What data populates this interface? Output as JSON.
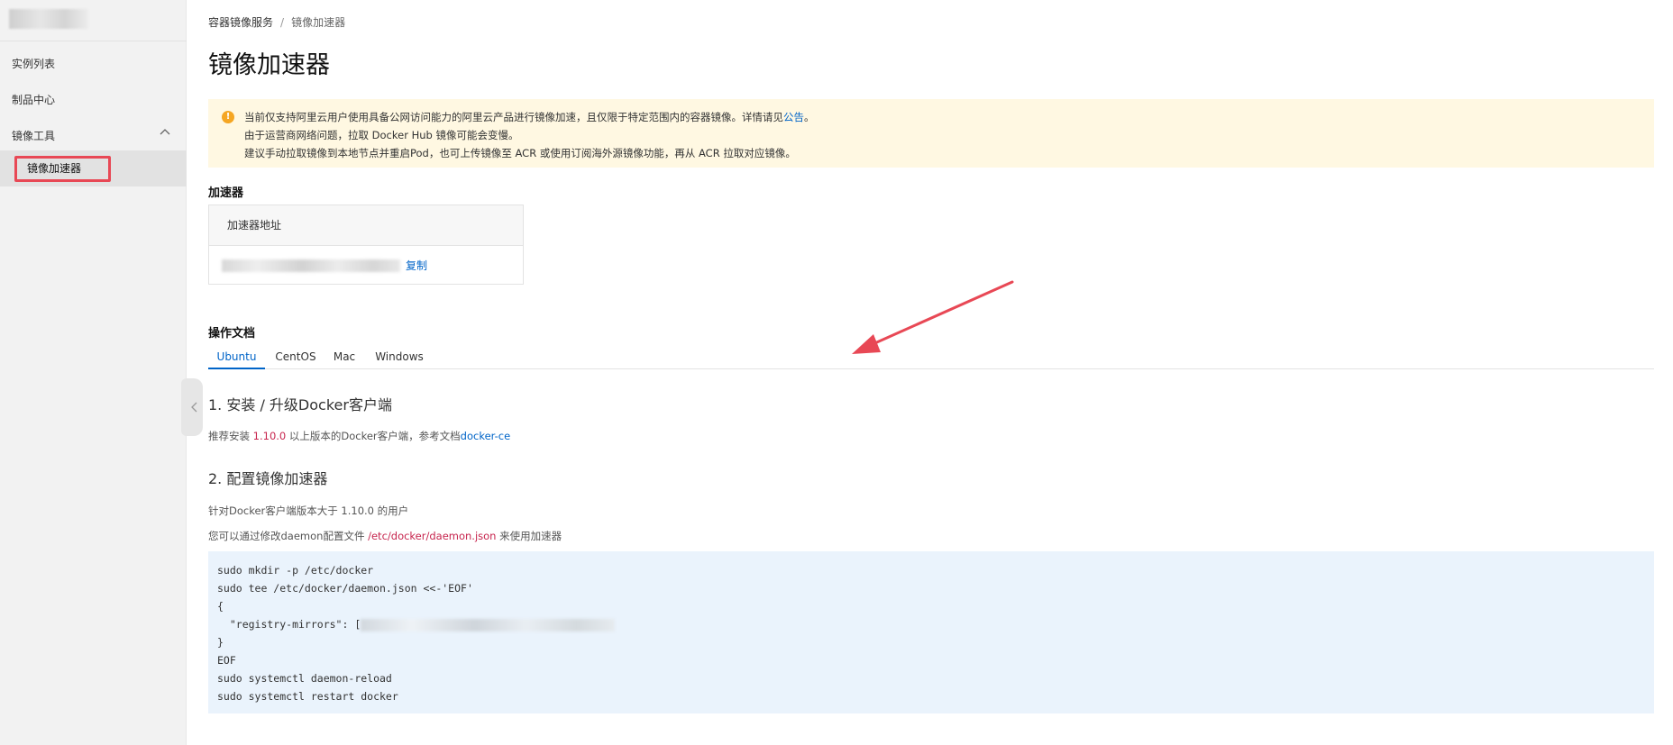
{
  "sidebar": {
    "items": [
      {
        "label": "实例列表"
      },
      {
        "label": "制品中心"
      },
      {
        "label": "镜像工具"
      }
    ],
    "active_item": "镜像加速器"
  },
  "breadcrumb": {
    "parent": "容器镜像服务",
    "separator": "/",
    "current": "镜像加速器"
  },
  "page_title": "镜像加速器",
  "notice": {
    "icon": "warning-icon",
    "line1_prefix": "当前仅支持阿里云用户使用具备公网访问能力的阿里云产品进行镜像加速，且仅限于特定范围内的容器镜像。详情请见",
    "line1_link": "公告",
    "line1_suffix": "。",
    "line2": "由于运营商网络问题，拉取 Docker Hub 镜像可能会变慢。",
    "line3": "建议手动拉取镜像到本地节点并重启Pod，也可上传镜像至 ACR 或使用订阅海外源镜像功能，再从 ACR 拉取对应镜像。"
  },
  "accelerator": {
    "section_title": "加速器",
    "column_header": "加速器地址",
    "copy_label": "复制"
  },
  "docs": {
    "section_title": "操作文档",
    "tabs": [
      "Ubuntu",
      "CentOS",
      "Mac",
      "Windows"
    ],
    "active_tab": "Ubuntu",
    "step1_title": "1. 安装 / 升级Docker客户端",
    "step1_prefix": "推荐安装 ",
    "step1_version": "1.10.0",
    "step1_middle": " 以上版本的Docker客户端，参考文档",
    "step1_link": "docker-ce",
    "step2_title": "2. 配置镜像加速器",
    "step2_p1": "针对Docker客户端版本大于 1.10.0 的用户",
    "step2_p2_prefix": "您可以通过修改daemon配置文件 ",
    "step2_p2_path": "/etc/docker/daemon.json",
    "step2_p2_suffix": " 来使用加速器",
    "code": {
      "line1": "sudo mkdir -p /etc/docker",
      "line2": "sudo tee /etc/docker/daemon.json <<-'EOF'",
      "line3": "{",
      "line4": "  \"registry-mirrors\": [",
      "line5": "}",
      "line6": "EOF",
      "line7": "sudo systemctl daemon-reload",
      "line8": "sudo systemctl restart docker"
    }
  },
  "colors": {
    "accent_blue": "#0064c8",
    "highlight_red": "#e84855",
    "notice_bg": "#fff8e2",
    "code_bg": "#eaf3fc",
    "annotation_arrow": "#e84855"
  }
}
